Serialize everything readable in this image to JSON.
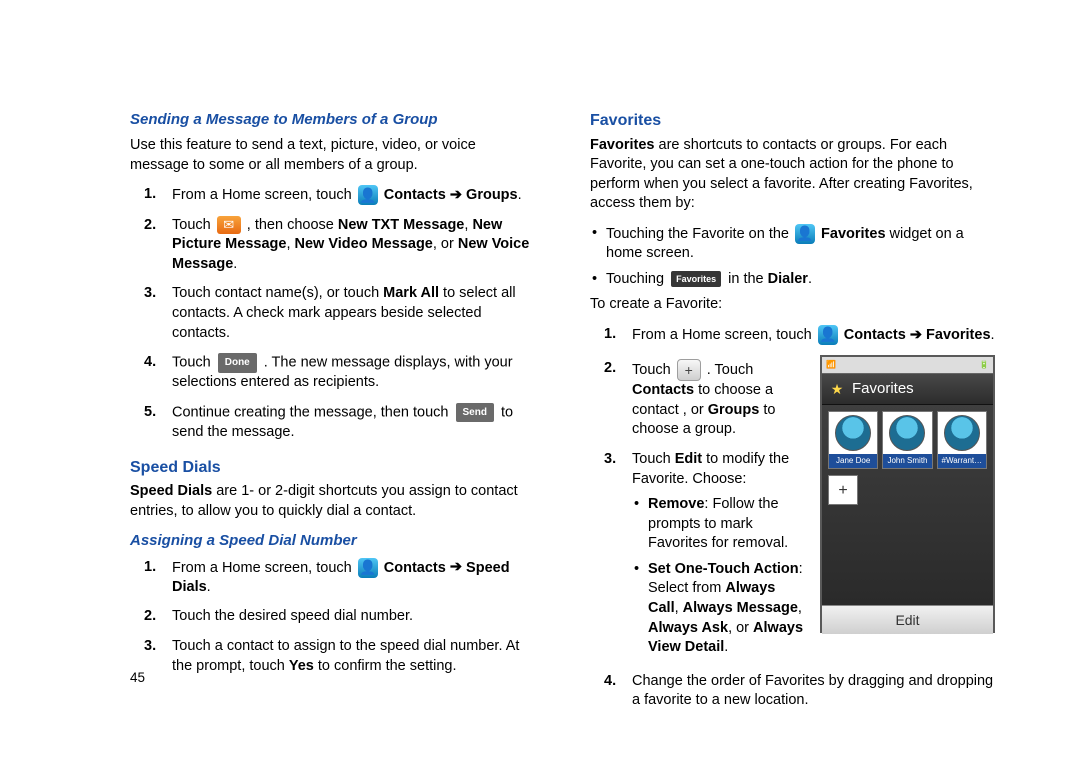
{
  "page_number": "45",
  "left": {
    "subhead1": "Sending a Message to Members of a Group",
    "intro": "Use this feature to send a text, picture, video, or voice message to some or all members of a group.",
    "step1_a": "From a Home screen, touch ",
    "contacts_label": "Contacts",
    "groups_label": "Groups",
    "step2_a": "Touch ",
    "step2_b": ", then choose ",
    "new_txt": "New TXT Message",
    "new_pic": "New Picture Message",
    "new_vid": "New Video Message",
    "new_voice": "New Voice Message",
    "step3_a": "Touch contact name(s), or touch ",
    "mark_all": "Mark All",
    "step3_b": " to select all contacts. A check mark appears beside selected contacts.",
    "step4_a": "Touch ",
    "done_chip": "Done",
    "step4_b": ". The new message displays, with your selections entered as recipients.",
    "step5_a": "Continue creating the message, then touch ",
    "send_chip": "Send",
    "step5_b": " to send the message.",
    "sect_speed": "Speed Dials",
    "speed_para_a": "Speed Dials",
    "speed_para_b": " are 1- or 2-digit shortcuts you assign to contact entries, to allow you to quickly dial a contact.",
    "subhead2": "Assigning a Speed Dial Number",
    "sd1_a": "From a Home screen, touch ",
    "speed_dials_label": "Speed Dials",
    "sd2": "Touch the desired speed dial number.",
    "sd3_a": "Touch a contact to assign to the speed dial number.  At the prompt, touch ",
    "yes": "Yes",
    "sd3_b": " to confirm the setting."
  },
  "right": {
    "sect_fav": "Favorites",
    "fav_para": " are shortcuts to contacts or groups.  For each Favorite, you can set a one-touch action for the phone to perform when you select a favorite. After creating Favorites, access them by:",
    "b1_a": "Touching the Favorite on the ",
    "b1_b": "Favorites",
    "b1_c": " widget on a home screen.",
    "b2_a": "Touching ",
    "fav_chip": "Favorites",
    "b2_b": " in the ",
    "dialer": "Dialer",
    "create": "To create a Favorite:",
    "f1_a": "From a Home screen, touch ",
    "favorites_label": "Favorites",
    "f2_a": "Touch ",
    "f2_b": ". Touch ",
    "contacts_b": "Contacts",
    "f2_c": " to choose a contact , or ",
    "groups_b": "Groups",
    "f2_d": " to choose a group.",
    "f3_a": "Touch ",
    "edit": "Edit",
    "f3_b": " to modify the Favorite. Choose:",
    "rb1_a": "Remove",
    "rb1_b": ": Follow the prompts to mark Favorites for removal.",
    "rb2_a": "Set One-Touch Action",
    "rb2_b": ": Select from ",
    "ac": "Always Call",
    "am": "Always Message",
    "aa": "Always Ask",
    "avd": "Always View Detail",
    "f4": "Change the order of Favorites by dragging and dropping a favorite to a new location."
  },
  "phone": {
    "title": "Favorites",
    "edit": "Edit",
    "c1": "Jane Doe",
    "c2": "John Smith",
    "c3": "#Warrant…"
  }
}
